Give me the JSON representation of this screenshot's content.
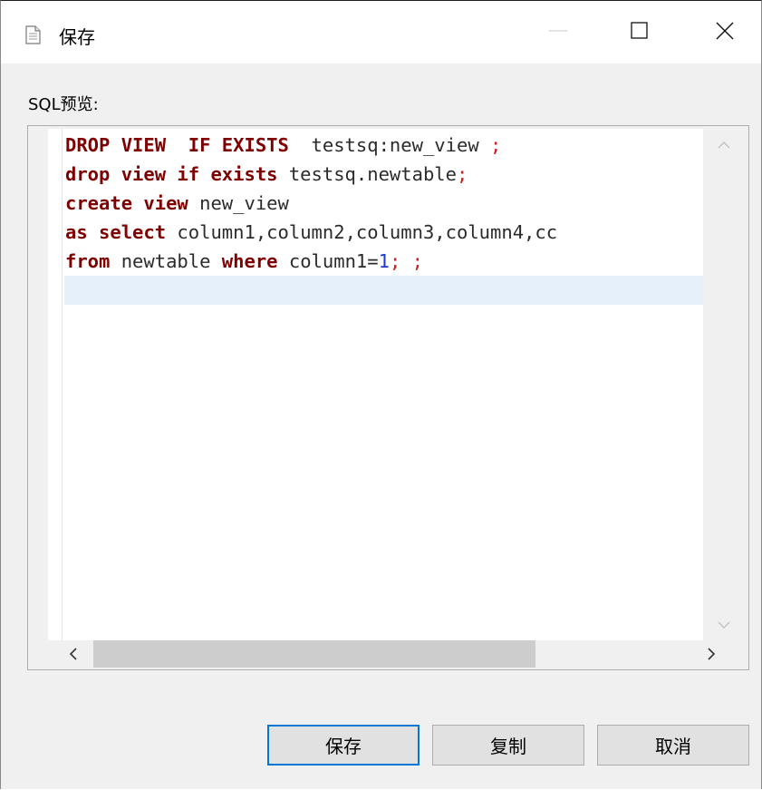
{
  "window": {
    "title": "保存",
    "controls": {
      "minimize_icon": "minimize-icon",
      "maximize_icon": "maximize-icon",
      "close_icon": "close-icon"
    }
  },
  "preview": {
    "label": "SQL预览:",
    "lines": [
      [
        {
          "t": "DROP VIEW  IF EXISTS",
          "c": "kw"
        },
        {
          "t": "  testsq:new_view ",
          "c": ""
        },
        {
          "t": ";",
          "c": "semi"
        }
      ],
      [
        {
          "t": "drop view if exists",
          "c": "kw"
        },
        {
          "t": " testsq.newtable",
          "c": ""
        },
        {
          "t": ";",
          "c": "semi"
        }
      ],
      [
        {
          "t": "create view",
          "c": "kw"
        },
        {
          "t": " new_view",
          "c": ""
        }
      ],
      [
        {
          "t": "as select",
          "c": "kw"
        },
        {
          "t": " column1,column2,column3,column4,cc",
          "c": ""
        }
      ],
      [
        {
          "t": "from",
          "c": "kw"
        },
        {
          "t": " newtable ",
          "c": ""
        },
        {
          "t": "where",
          "c": "kw"
        },
        {
          "t": " column1=",
          "c": ""
        },
        {
          "t": "1",
          "c": "num"
        },
        {
          "t": ";",
          "c": "semi"
        },
        {
          "t": " ",
          "c": ""
        },
        {
          "t": ";",
          "c": "semi"
        }
      ],
      []
    ],
    "current_line_index": 5
  },
  "buttons": {
    "save": "保存",
    "copy": "复制",
    "cancel": "取消"
  },
  "colors": {
    "keyword": "#7f0000",
    "semicolon": "#d11a1a",
    "number": "#1a3ad1",
    "current_line": "#e6f0fb",
    "primary_border": "#0078d7"
  }
}
